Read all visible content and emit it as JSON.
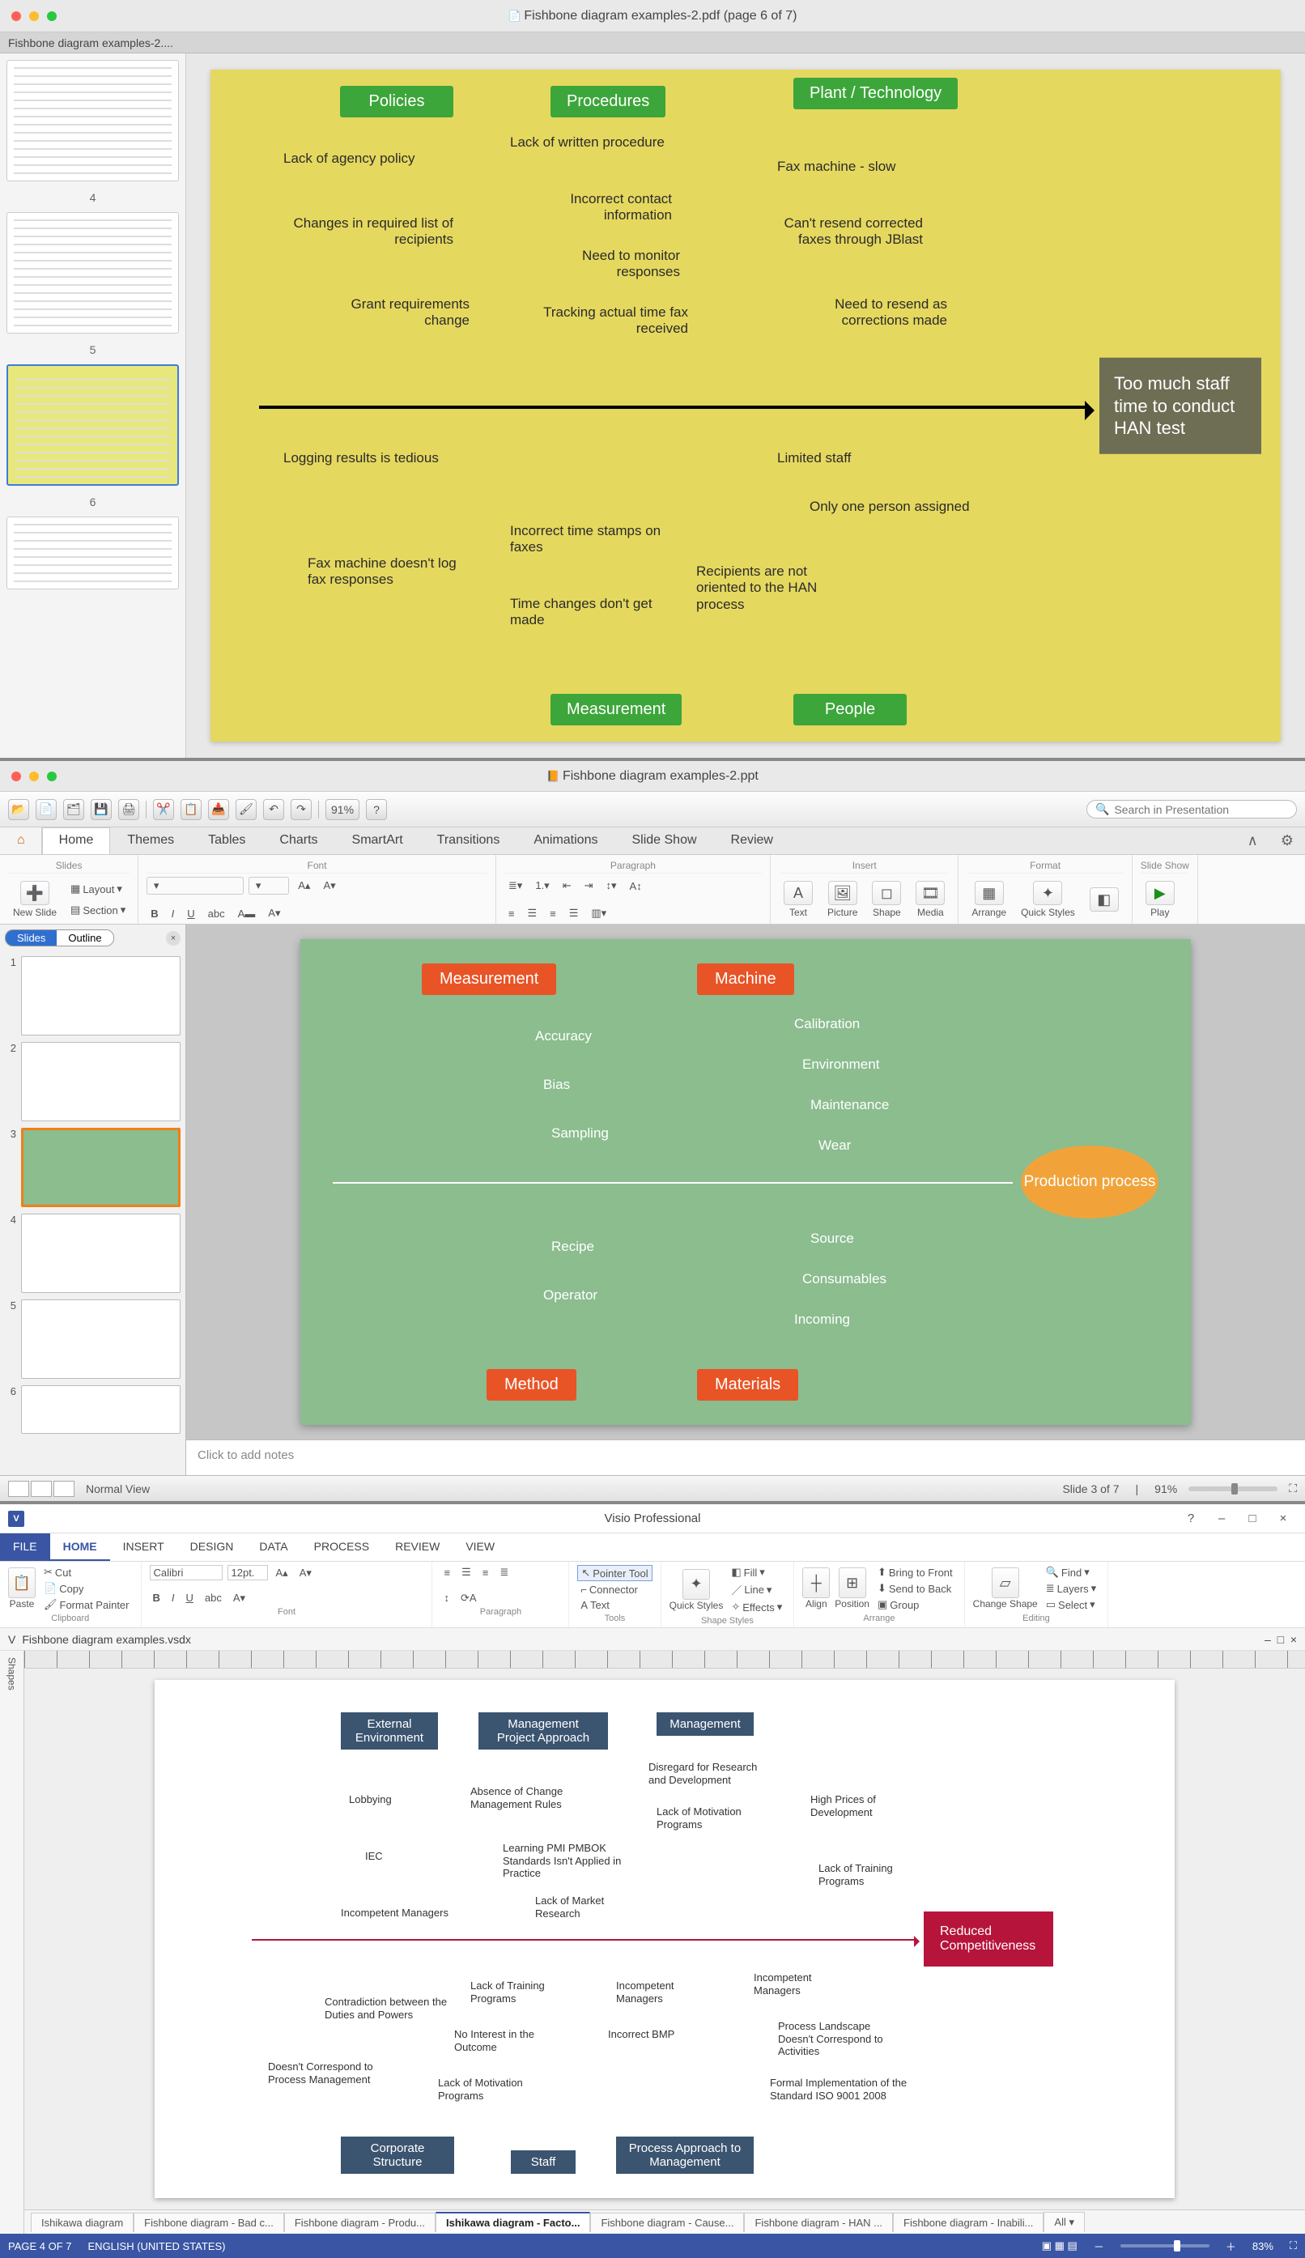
{
  "pdf": {
    "window_title": "Fishbone diagram examples-2.pdf (page 6 of 7)",
    "tab": "Fishbone diagram examples-2....",
    "thumb_labels": [
      "4",
      "5",
      "6"
    ],
    "selected_thumb": 2,
    "categories": {
      "policies": "Policies",
      "procedures": "Procedures",
      "plant": "Plant / Technology",
      "measurement": "Measurement",
      "people": "People"
    },
    "effect": "Too much staff time to conduct HAN test",
    "bones": {
      "policies": [
        "Lack of agency policy",
        "Changes in required list of recipients",
        "Grant requirements change"
      ],
      "procedures": [
        "Lack of written procedure",
        "Incorrect contact information",
        "Need to monitor responses",
        "Tracking actual time fax received"
      ],
      "plant": [
        "Fax machine - slow",
        "Can't resend corrected faxes through JBlast",
        "Need to resend as corrections made"
      ],
      "measurement": [
        "Logging results is tedious",
        "Fax machine doesn't log fax responses",
        "Incorrect time stamps on faxes",
        "Time changes don't get made"
      ],
      "people": [
        "Limited staff",
        "Only one person assigned",
        "Recipients are not oriented to the HAN process"
      ]
    }
  },
  "ppt": {
    "window_title": "Fishbone diagram examples-2.ppt",
    "search_placeholder": "Search in Presentation",
    "zoom_field": "91%",
    "tabs": [
      "Home",
      "Themes",
      "Tables",
      "Charts",
      "SmartArt",
      "Transitions",
      "Animations",
      "Slide Show",
      "Review"
    ],
    "active_tab": "Home",
    "ribbon_groups": [
      "Slides",
      "Font",
      "Paragraph",
      "Insert",
      "Format",
      "Slide Show"
    ],
    "slides_group": {
      "new_slide": "New Slide",
      "layout": "Layout",
      "section": "Section"
    },
    "insert_items": [
      "Text",
      "Picture",
      "Shape",
      "Media"
    ],
    "format_items": [
      "Arrange",
      "Quick Styles"
    ],
    "play": "Play",
    "side_tabs": {
      "slides": "Slides",
      "outline": "Outline"
    },
    "selected_slide": 3,
    "slide_count": 6,
    "categories": {
      "measurement": "Measurement",
      "machine": "Machine",
      "method": "Method",
      "materials": "Materials"
    },
    "effect": "Production process",
    "bones": {
      "measurement": [
        "Accuracy",
        "Bias",
        "Sampling"
      ],
      "machine": [
        "Calibration",
        "Environment",
        "Maintenance",
        "Wear"
      ],
      "method": [
        "Recipe",
        "Operator"
      ],
      "materials": [
        "Source",
        "Consumables",
        "Incoming"
      ]
    },
    "notes_placeholder": "Click to add notes",
    "status": {
      "view": "Normal View",
      "slide": "Slide 3 of 7",
      "zoom": "91%"
    }
  },
  "visio": {
    "app_title": "Visio Professional",
    "help_hint": "?",
    "window_controls": [
      "–",
      "□",
      "×"
    ],
    "tabs": [
      "FILE",
      "HOME",
      "INSERT",
      "DESIGN",
      "DATA",
      "PROCESS",
      "REVIEW",
      "VIEW"
    ],
    "active_tab": "HOME",
    "clipboard": {
      "paste": "Paste",
      "cut": "Cut",
      "copy": "Copy",
      "fmt": "Format Painter",
      "label": "Clipboard"
    },
    "font": {
      "family": "Calibri",
      "size": "12pt.",
      "label": "Font"
    },
    "paragraph_label": "Paragraph",
    "tools": {
      "pointer": "Pointer Tool",
      "connector": "Connector",
      "text": "Text",
      "label": "Tools"
    },
    "shape_styles": {
      "quick": "Quick Styles",
      "fill": "Fill",
      "line": "Line",
      "effects": "Effects",
      "label": "Shape Styles"
    },
    "arrange": {
      "align": "Align",
      "position": "Position",
      "bring": "Bring to Front",
      "send": "Send to Back",
      "group": "Group",
      "label": "Arrange"
    },
    "editing": {
      "change": "Change Shape",
      "find": "Find",
      "layers": "Layers",
      "select": "Select",
      "label": "Editing"
    },
    "doc_title": "Fishbone diagram examples.vsdx",
    "shapes_label": "Shapes",
    "categories": {
      "ext": "External Environment",
      "mgmt_approach": "Management Project Approach",
      "mgmt": "Management",
      "corp": "Corporate Structure",
      "staff": "Staff",
      "process": "Process Approach to Management"
    },
    "effect": "Reduced Competitiveness",
    "bones": {
      "ext": [
        "Lobbying",
        "IEC",
        "Incompetent Managers"
      ],
      "mgmt_approach": [
        "Absence of Change Management Rules",
        "Learning PMI PMBOK Standards Isn't Applied in Practice",
        "Lack of Market Research"
      ],
      "mgmt": [
        "Disregard for Research and Development",
        "Lack of Motivation Programs",
        "High Prices of Development",
        "Lack of Training Programs"
      ],
      "corp": [
        "Contradiction between the Duties and Powers",
        "Doesn't Correspond to Process Management"
      ],
      "staff": [
        "Lack of Training Programs",
        "No Interest in the Outcome",
        "Lack of Motivation Programs"
      ],
      "process": [
        "Incompetent Managers",
        "Incorrect BMP",
        "Incompetent Managers",
        "Process Landscape Doesn't Correspond to Activities",
        "Formal Implementation of the Standard ISO 9001 2008"
      ]
    },
    "sheet_tabs": [
      "Ishikawa diagram",
      "Fishbone diagram - Bad c...",
      "Fishbone diagram - Produ...",
      "Ishikawa diagram - Facto...",
      "Fishbone diagram - Cause...",
      "Fishbone diagram - HAN ...",
      "Fishbone diagram - Inabili...",
      "All ▾"
    ],
    "active_sheet": 3,
    "status": {
      "page": "PAGE 4 OF 7",
      "lang": "ENGLISH (UNITED STATES)",
      "zoom": "83%"
    }
  }
}
